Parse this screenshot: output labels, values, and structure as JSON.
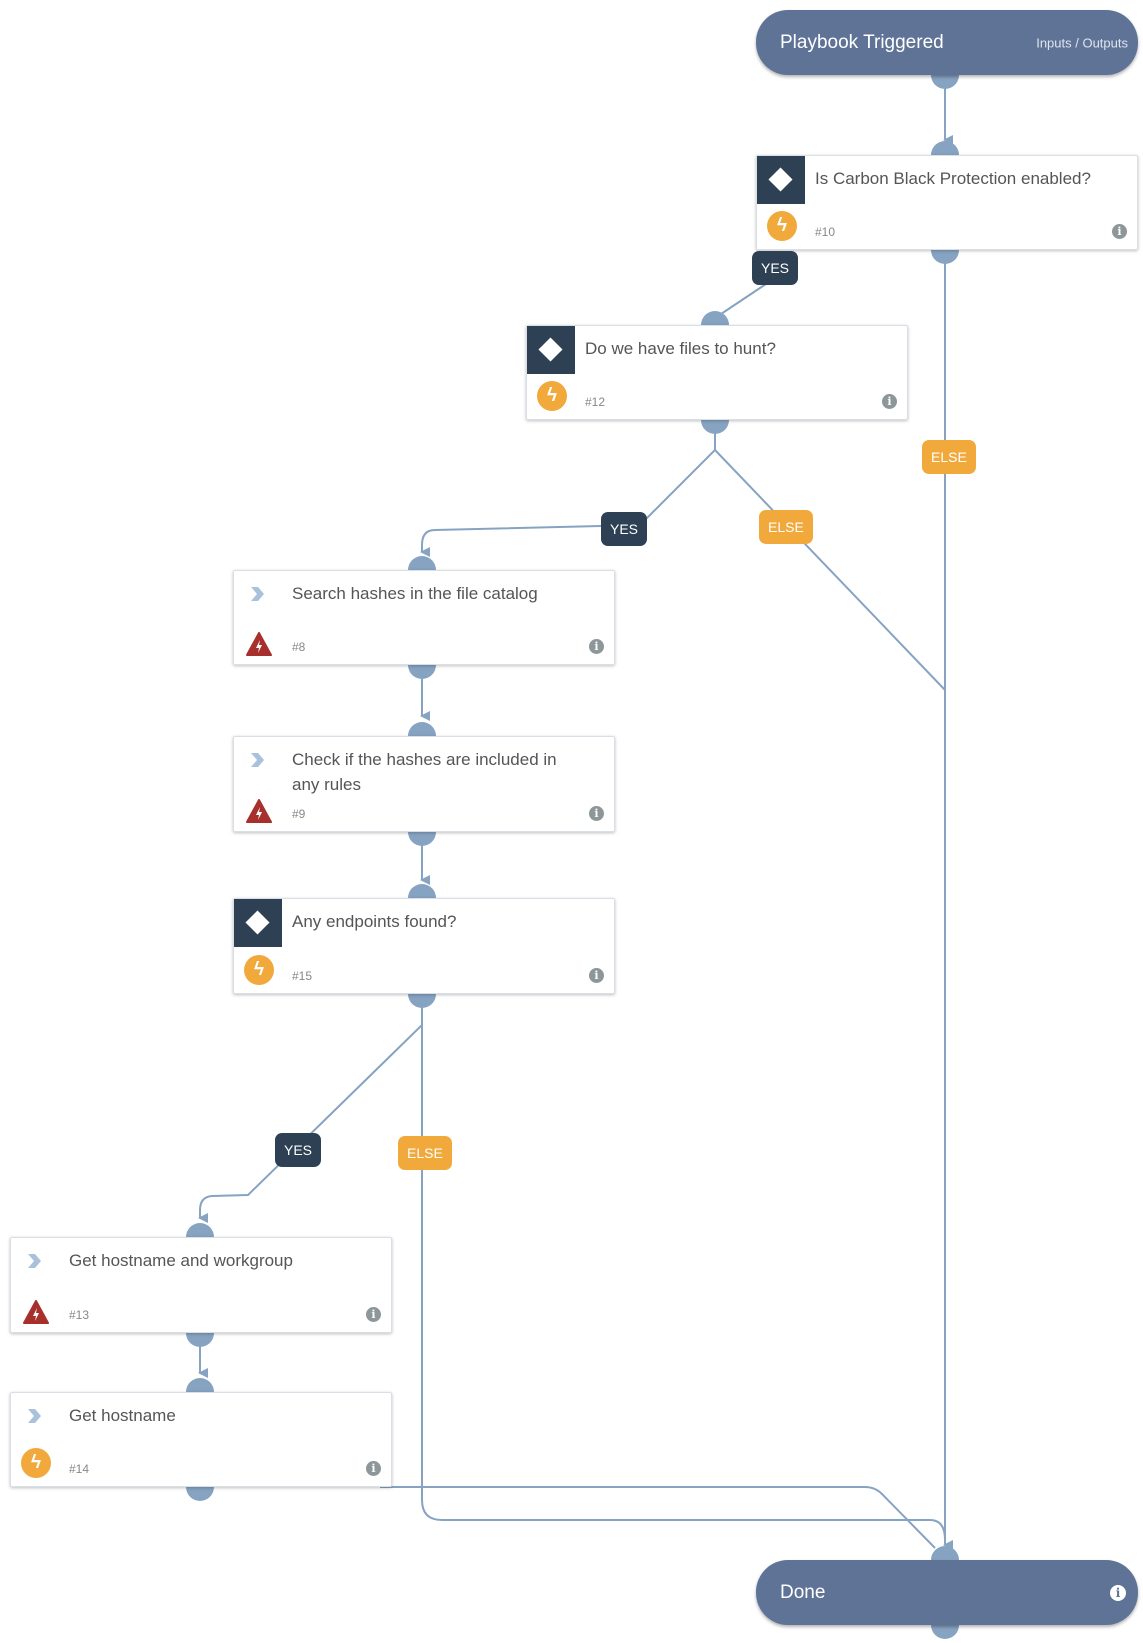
{
  "start": {
    "title": "Playbook Triggered",
    "link": "Inputs / Outputs"
  },
  "end": {
    "title": "Done",
    "icon": "info-icon"
  },
  "nodes": [
    {
      "id": "10",
      "type": "condition",
      "title": "Is Carbon Black Protection enabled?",
      "num": "#10",
      "status_icon": "bolt-icon"
    },
    {
      "id": "12",
      "type": "condition",
      "title": "Do we have files to hunt?",
      "num": "#12",
      "status_icon": "bolt-icon"
    },
    {
      "id": "8",
      "type": "task",
      "title": "Search hashes in the file catalog",
      "num": "#8",
      "status_icon": "warning-icon"
    },
    {
      "id": "9",
      "type": "task",
      "title": "Check if the hashes are included in any rules",
      "num": "#9",
      "status_icon": "warning-icon"
    },
    {
      "id": "15",
      "type": "condition",
      "title": "Any endpoints found?",
      "num": "#15",
      "status_icon": "bolt-icon"
    },
    {
      "id": "13",
      "type": "task",
      "title": "Get hostname and workgroup",
      "num": "#13",
      "status_icon": "warning-icon"
    },
    {
      "id": "14",
      "type": "task",
      "title": "Get hostname",
      "num": "#14",
      "status_icon": "bolt-icon"
    }
  ],
  "labels": {
    "yes": "YES",
    "else": "ELSE",
    "info": "i"
  },
  "colors": {
    "start_end": "#5f7397",
    "edge": "#87a3c2",
    "yes_badge": "#2e4053",
    "else_badge": "#f2a93b",
    "warning": "#a8302c"
  }
}
